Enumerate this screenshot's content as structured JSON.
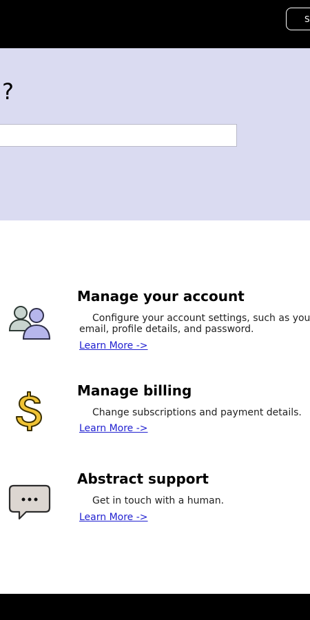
{
  "header": {
    "submit_label": "Submit"
  },
  "hero": {
    "title_visible": "?",
    "search_value": ""
  },
  "cards": [
    {
      "title": "Manage your account",
      "description": "Configure your account settings, such as your email, profile details, and password.",
      "link": "Learn More ->",
      "icon": "users-icon"
    },
    {
      "title": "Manage billing",
      "description": "Change subscriptions and payment details.",
      "link": "Learn More ->",
      "icon": "dollar-icon"
    },
    {
      "title": "Abstract support",
      "description": "Get in touch with a human.",
      "link": "Learn More ->",
      "icon": "chat-bubble-icon"
    }
  ],
  "colors": {
    "header_bg": "#000000",
    "hero_bg": "#dadbf1",
    "link": "#1f1fd0",
    "footer_bg": "#000000"
  }
}
